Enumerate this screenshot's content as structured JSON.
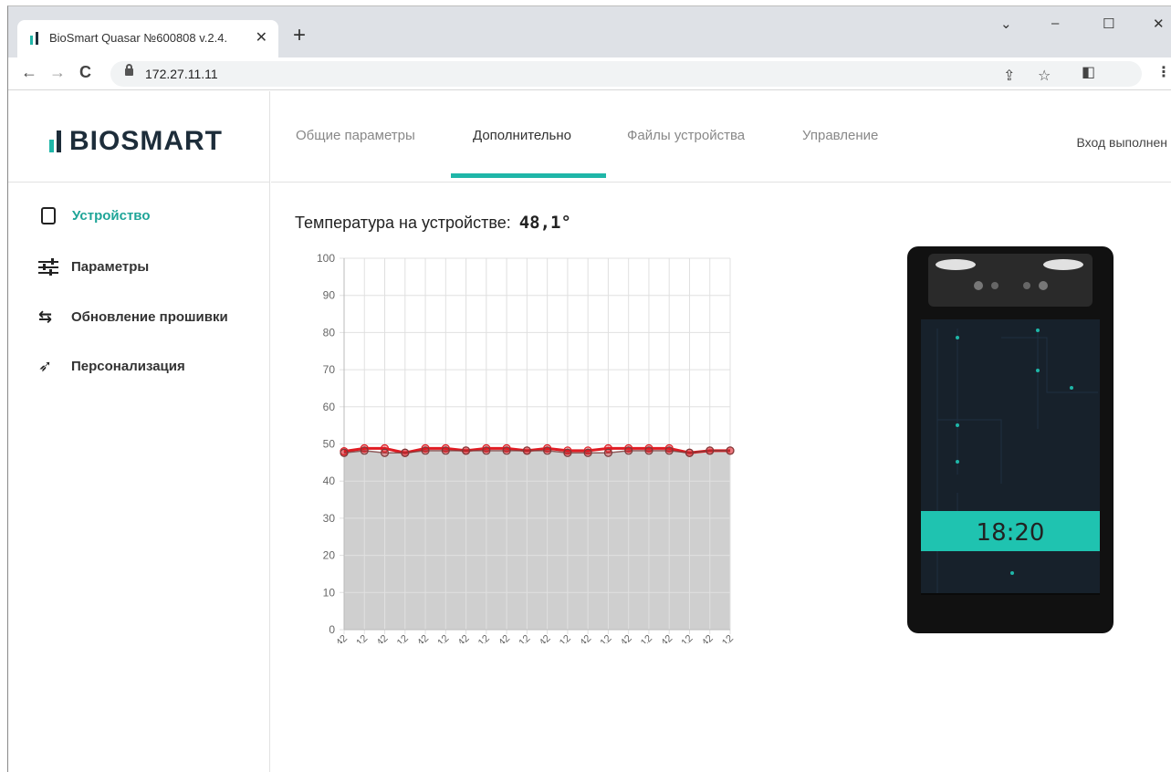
{
  "browser": {
    "tab_title": "BioSmart Quasar №600808 v.2.4.",
    "tab_close": "✕",
    "new_tab": "+",
    "window_controls": {
      "dropdown": "⌄",
      "minimize": "–",
      "maximize": "☐",
      "close": "✕"
    },
    "url": "172.27.11.11",
    "nav": {
      "back": "←",
      "forward": "→",
      "reload": "C"
    },
    "toolbar_icons": {
      "share": "⇪",
      "star": "☆",
      "sidepanel": "◧",
      "menu": "⋮"
    }
  },
  "app": {
    "logo_text": "BIOSMART",
    "top_nav": [
      {
        "label": "Общие параметры",
        "active": false
      },
      {
        "label": "Дополнительно",
        "active": true
      },
      {
        "label": "Файлы устройства",
        "active": false
      },
      {
        "label": "Управление",
        "active": false
      }
    ],
    "login_status": "Вход выполнен",
    "sidebar": [
      {
        "label": "Устройство",
        "icon": "tablet-icon",
        "active": true
      },
      {
        "label": "Параметры",
        "icon": "sliders-icon",
        "active": false
      },
      {
        "label": "Обновление прошивки",
        "icon": "update-icon",
        "active": false
      },
      {
        "label": "Персонализация",
        "icon": "rocket-icon",
        "active": false
      }
    ],
    "temperature_label": "Температура на устройстве:",
    "temperature_value": "48,1°",
    "device_screen_time": "18:20",
    "accent_color": "#1fb6a8",
    "line_color": "#e01b22"
  },
  "chart_data": {
    "type": "line",
    "ylim": [
      0,
      100
    ],
    "yticks": [
      0,
      10,
      20,
      30,
      40,
      50,
      60,
      70,
      80,
      90,
      100
    ],
    "categories": [
      "17:03:42",
      "17:04:12",
      "17:04:42",
      "17:05:12",
      "17:05:42",
      "17:06:12",
      "17:06:42",
      "17:07:12",
      "17:07:42",
      "17:08:12",
      "17:08:42",
      "17:09:12",
      "17:09:42",
      "17:10:12",
      "17:10:42",
      "17:11:12",
      "17:11:42",
      "17:12:12",
      "17:12:42",
      "17:13:12"
    ],
    "series": [
      {
        "values": [
          48.0,
          48.8,
          48.8,
          47.6,
          48.8,
          48.8,
          48.2,
          48.8,
          48.8,
          48.2,
          48.8,
          48.2,
          48.2,
          48.8,
          48.8,
          48.8,
          48.8,
          47.6,
          48.2,
          48.2
        ]
      },
      {
        "values": [
          47.6,
          48.2,
          47.6,
          47.6,
          48.2,
          48.2,
          48.2,
          48.2,
          48.2,
          48.2,
          48.2,
          47.6,
          47.6,
          47.6,
          48.2,
          48.2,
          48.2,
          47.6,
          48.2,
          48.2
        ]
      }
    ],
    "grid": true,
    "fill_under": true
  }
}
